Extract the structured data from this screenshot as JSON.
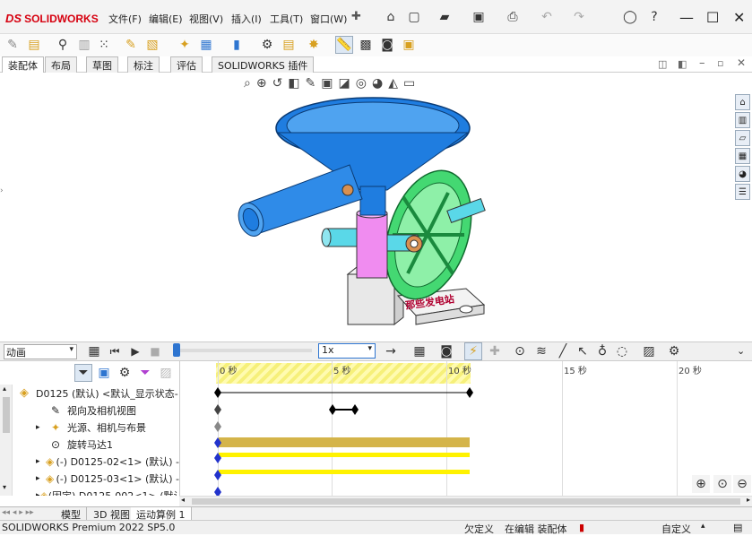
{
  "app": {
    "logo_text": "SOLIDWORKS",
    "logo_ds": "DS"
  },
  "menu": [
    "文件(F)",
    "编辑(E)",
    "视图(V)",
    "插入(I)",
    "工具(T)",
    "窗口(W)"
  ],
  "cm_tabs": [
    "装配体",
    "布局",
    "草图",
    "标注",
    "评估",
    "SOLIDWORKS 插件"
  ],
  "model": {
    "stamp_text": "那些发电站"
  },
  "motion": {
    "study_type": "动画",
    "speed": "1x"
  },
  "timeline": {
    "ticks": [
      "0 秒",
      "5 秒",
      "10 秒",
      "15 秒",
      "20 秒"
    ]
  },
  "tree": {
    "items": [
      {
        "label": "D0125 (默认) <默认_显示状态-"
      },
      {
        "label": "视向及相机视图"
      },
      {
        "label": "光源、相机与布景"
      },
      {
        "label": "旋转马达1"
      },
      {
        "label": "(-) D0125-02<1> (默认) -"
      },
      {
        "label": "(-) D0125-03<1> (默认) -"
      },
      {
        "label": "(固定) D0125-002<1> (默认"
      }
    ]
  },
  "bottom_tabs": [
    "模型",
    "3D 视图",
    "运动算例 1"
  ],
  "status": {
    "product": "SOLIDWORKS Premium 2022 SP5.0",
    "underdefined": "欠定义",
    "editing": "在编辑 装配体",
    "custom": "自定义"
  },
  "colors": {
    "funnel": "#1f7de0",
    "flywheel": "#3fd66a",
    "pink": "#f08cf0",
    "cyan": "#5ad8e8",
    "keybar": "#d4b44a",
    "yellowbar": "#fff200",
    "accent": "#2e75d0"
  }
}
